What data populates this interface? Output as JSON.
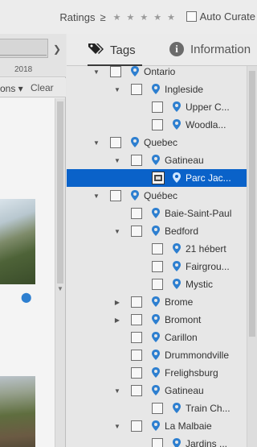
{
  "ratings": {
    "label": "Ratings",
    "operator": "≥",
    "stars": [
      "★",
      "★",
      "★",
      "★",
      "★"
    ]
  },
  "auto_curate": {
    "label": "Auto Curate",
    "checked": false
  },
  "timeline": {
    "year": "2018"
  },
  "filterbar": {
    "options_label": "ons ▾",
    "clear_label": "Clear"
  },
  "tabs": {
    "tags_label": "Tags",
    "info_label": "Information"
  },
  "tree": [
    {
      "label": "Ontario",
      "level": 0,
      "expanded": true
    },
    {
      "label": "Ingleside",
      "level": 1,
      "expanded": true
    },
    {
      "label": "Upper C...",
      "level": 2,
      "expanded": null
    },
    {
      "label": "Woodla...",
      "level": 2,
      "expanded": null
    },
    {
      "label": "Quebec",
      "level": 0,
      "expanded": true
    },
    {
      "label": "Gatineau",
      "level": 1,
      "expanded": true
    },
    {
      "label": "Parc Jac...",
      "level": 2,
      "expanded": null,
      "selected": true
    },
    {
      "label": "Québec",
      "level": 0,
      "expanded": true
    },
    {
      "label": "Baie-Saint-Paul",
      "level": 1,
      "expanded": null
    },
    {
      "label": "Bedford",
      "level": 1,
      "expanded": true
    },
    {
      "label": "21 hébert",
      "level": 2,
      "expanded": null
    },
    {
      "label": "Fairgrou...",
      "level": 2,
      "expanded": null
    },
    {
      "label": "Mystic",
      "level": 2,
      "expanded": null
    },
    {
      "label": "Brome",
      "level": 1,
      "expanded": false
    },
    {
      "label": "Bromont",
      "level": 1,
      "expanded": false
    },
    {
      "label": "Carillon",
      "level": 1,
      "expanded": null
    },
    {
      "label": "Drummondville",
      "level": 1,
      "expanded": null
    },
    {
      "label": "Frelighsburg",
      "level": 1,
      "expanded": null
    },
    {
      "label": "Gatineau",
      "level": 1,
      "expanded": true
    },
    {
      "label": "Train Ch...",
      "level": 2,
      "expanded": null
    },
    {
      "label": "La Malbaie",
      "level": 1,
      "expanded": true
    },
    {
      "label": "Jardins ...",
      "level": 2,
      "expanded": null
    }
  ],
  "colors": {
    "selection": "#0a62c9",
    "keyword_icon": "#2d7fd0"
  },
  "icons": {
    "tags_tab": "tag-icon",
    "info_tab": "info-icon",
    "keyword": "map-pin-icon"
  }
}
